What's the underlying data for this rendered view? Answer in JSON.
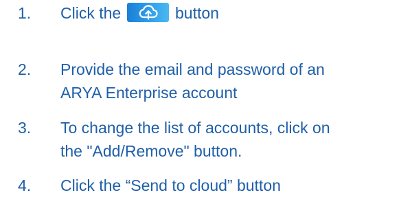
{
  "steps": [
    {
      "number": "1.",
      "before": "Click the",
      "button_icon": "cloud-upload-icon",
      "after": "button"
    },
    {
      "number": "2.",
      "line1": "Provide the email and password of an",
      "line2": "ARYA Enterprise account"
    },
    {
      "number": "3.",
      "line1": "To change the list of accounts, click on",
      "line2": "the \"Add/Remove\" button."
    },
    {
      "number": "4.",
      "text": "Click the “Send to cloud” button"
    }
  ],
  "colors": {
    "text": "#1f5fa8",
    "button_gradient_start": "#1a7fd6",
    "button_gradient_end": "#4bb8f2",
    "icon": "#ffffff"
  }
}
